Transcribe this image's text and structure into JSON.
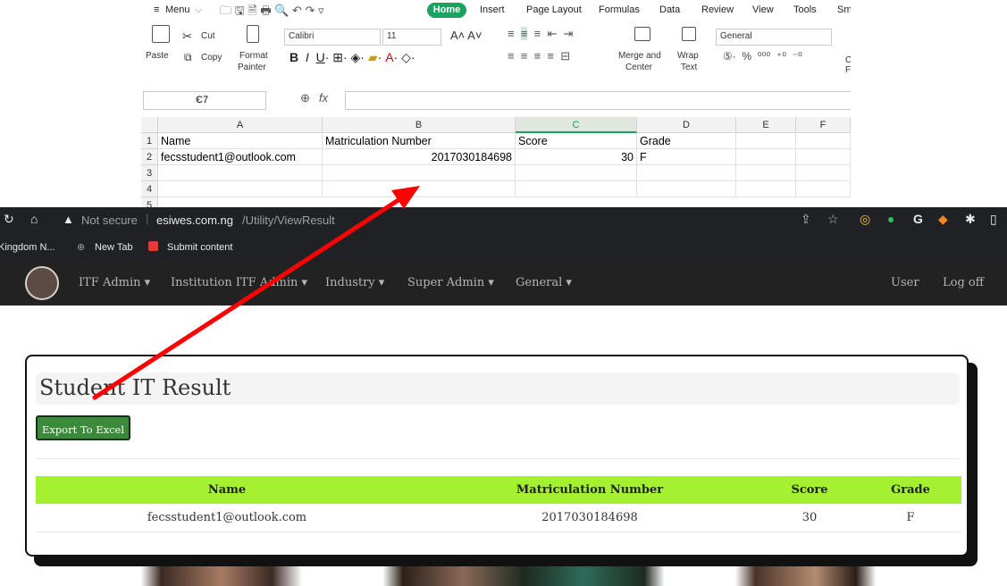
{
  "spreadsheet": {
    "menu_label": "Menu",
    "tabs": [
      "Home",
      "Insert",
      "Page Layout",
      "Formulas",
      "Data",
      "Review",
      "View",
      "Tools",
      "Sm"
    ],
    "ribbon": {
      "paste": "Paste",
      "cut": "Cut",
      "copy": "Copy",
      "format_painter_1": "Format",
      "format_painter_2": "Painter",
      "font_name": "Calibri",
      "font_size": "11",
      "merge_1": "Merge and",
      "merge_2": "Center",
      "wrap_1": "Wrap",
      "wrap_2": "Text",
      "number_format": "General",
      "cut_edge_1": "C",
      "cut_edge_2": "F"
    },
    "name_box": "C7",
    "fx_label": "fx",
    "columns": [
      "A",
      "B",
      "C",
      "D",
      "E",
      "F"
    ],
    "row_numbers": [
      "1",
      "2",
      "3",
      "4",
      "5"
    ],
    "rows": [
      [
        "Name",
        "Matriculation Number",
        "Score",
        "Grade"
      ],
      [
        "fecsstudent1@outlook.com",
        "2017030184698",
        "30",
        "F"
      ]
    ]
  },
  "browser": {
    "security": "Not secure",
    "url_domain": "esiwes.com.ng",
    "url_path": "/Utility/ViewResult",
    "bookmarks": [
      "Kingdom N...",
      "New Tab",
      "Submit content"
    ]
  },
  "site_nav": {
    "items": [
      "ITF Admin",
      "Institution ITF Admin",
      "Industry",
      "Super Admin",
      "General"
    ],
    "user": "User",
    "logoff": "Log off"
  },
  "page": {
    "title": "Student IT Result",
    "export_button": "Export To Excel",
    "table_headers": [
      "Name",
      "Matriculation Number",
      "Score",
      "Grade"
    ],
    "table_rows": [
      [
        "fecsstudent1@outlook.com",
        "2017030184698",
        "30",
        "F"
      ]
    ]
  },
  "colors": {
    "header_green": "#a4f132",
    "button_green": "#3a8a3a",
    "wps_green": "#1aa260",
    "arrow_red": "#ff0000",
    "nav_bg": "#222222"
  }
}
